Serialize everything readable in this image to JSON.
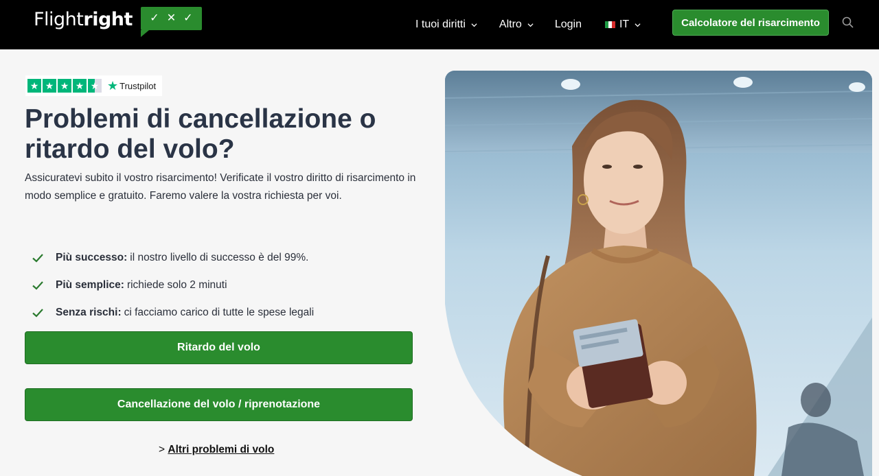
{
  "header": {
    "logo_light": "Flight",
    "logo_bold": "right",
    "logo_badge": [
      "✓",
      "✕",
      "✓"
    ],
    "nav": {
      "rights_label": "I tuoi diritti",
      "more_label": "Altro",
      "login_label": "Login",
      "lang_label": "IT"
    },
    "cta_label": "Calcolatore del risarcimento"
  },
  "trustpilot": {
    "rating_stars": 4.5,
    "brand": "Trustpilot"
  },
  "hero": {
    "title": "Problemi di cancellazione o ritardo del volo?",
    "subtitle": "Assicuratevi subito il vostro risarcimento! Verificate il vostro diritto di risarcimento in modo semplice e gratuito. Faremo valere la vostra richiesta per voi.",
    "benefits": [
      {
        "bold": "Più successo:",
        "text": "il nostro livello di successo è del 99%."
      },
      {
        "bold": "Più semplice:",
        "text": "richiede solo 2 minuti"
      },
      {
        "bold": "Senza rischi:",
        "text": "ci facciamo carico di tutte le spese legali"
      }
    ],
    "btn_delay": "Ritardo del volo",
    "btn_cancel": "Cancellazione del volo / riprenotazione",
    "other_prefix": ">",
    "other_link": "Altri problemi di volo"
  },
  "colors": {
    "brand_green": "#2a8c2e",
    "header_bg": "#000000",
    "trustpilot_green": "#00b67a"
  },
  "icons": [
    "chevron-down-icon",
    "italy-flag-icon",
    "search-icon",
    "check-icon",
    "star-icon"
  ]
}
